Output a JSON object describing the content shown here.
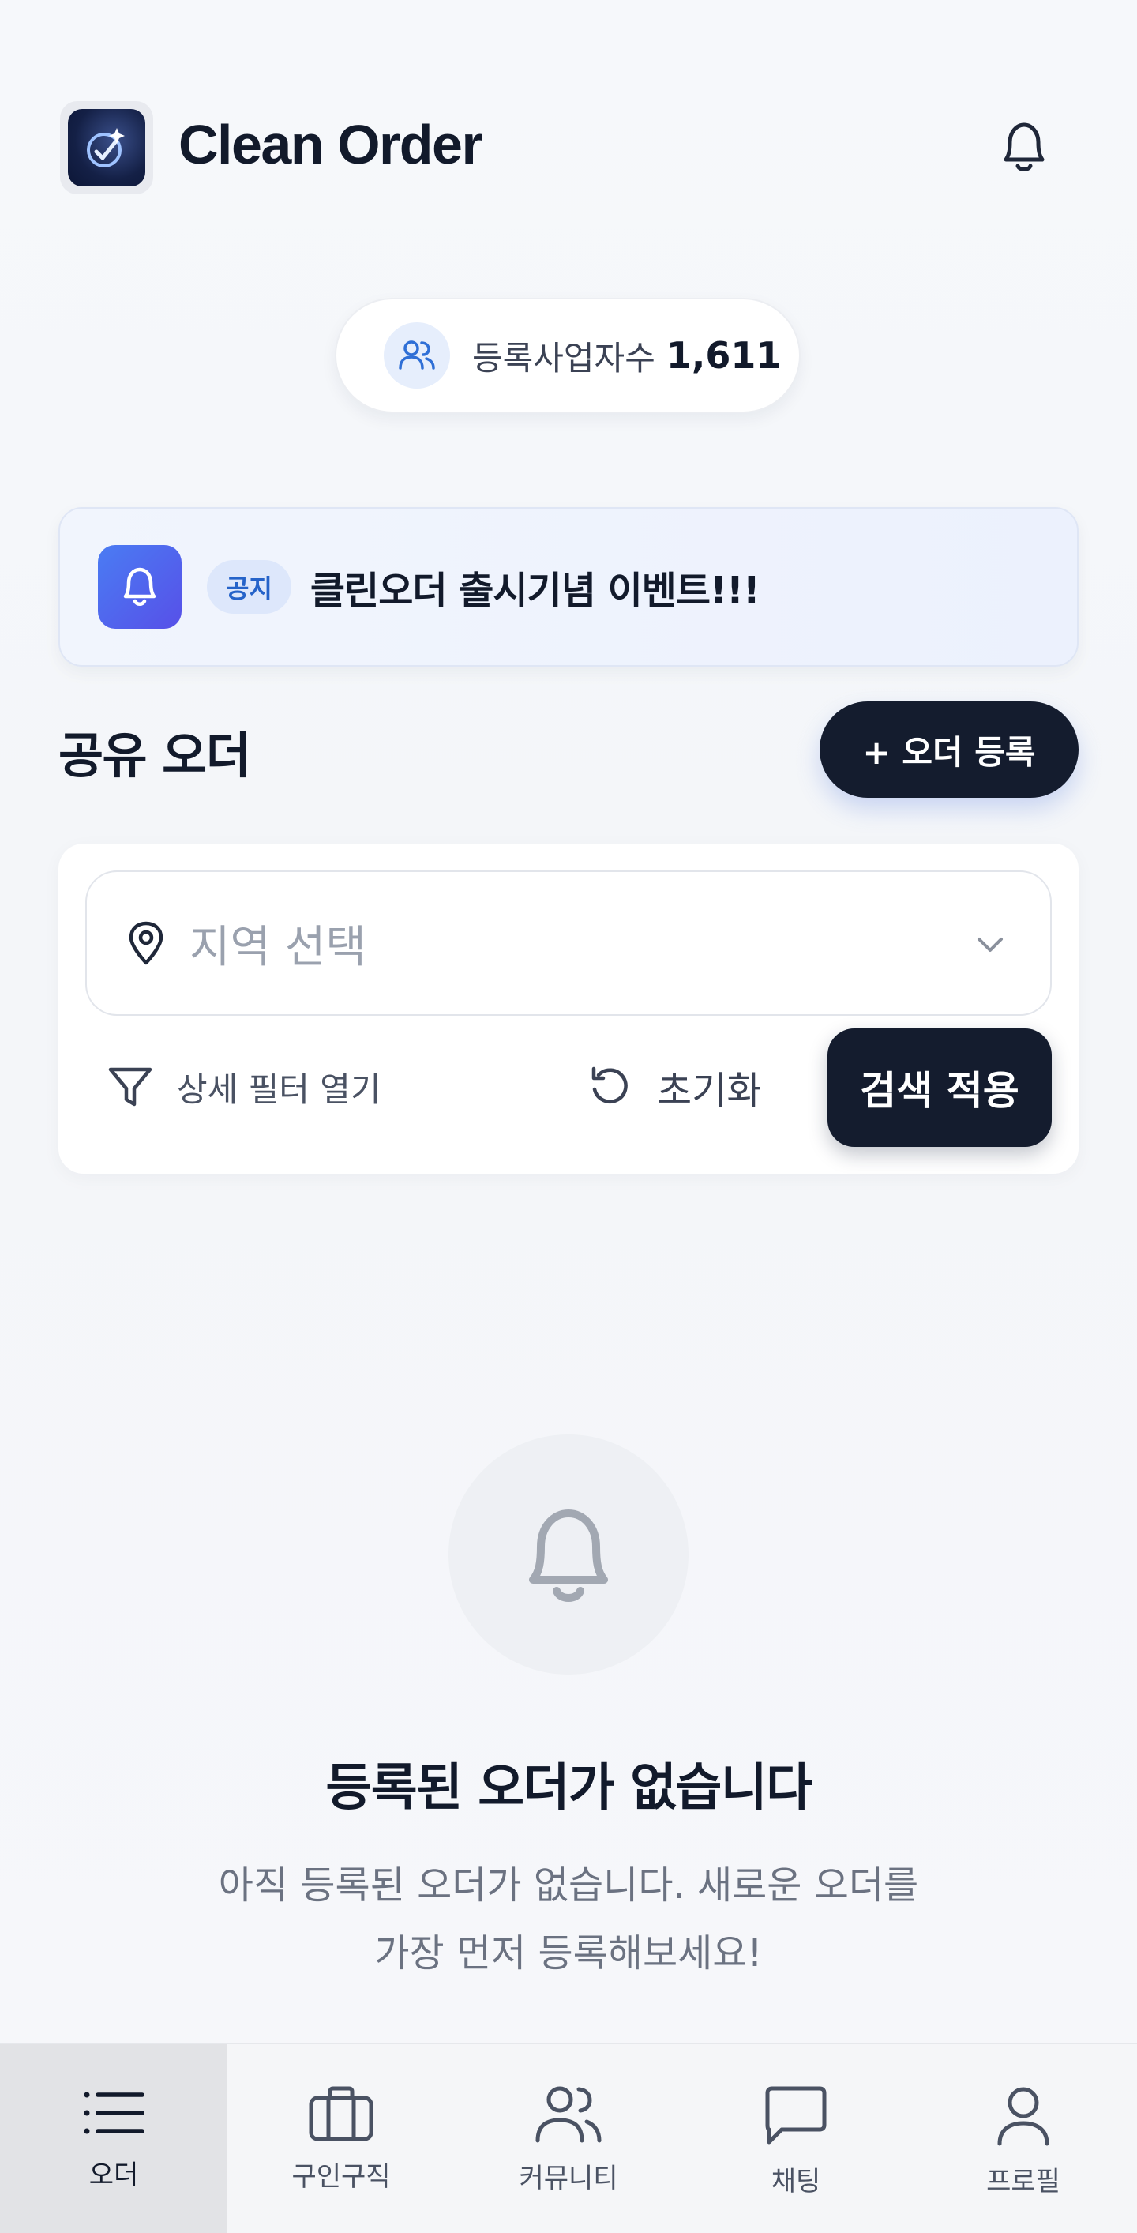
{
  "app": {
    "title": "Clean Order"
  },
  "stats": {
    "label": "등록사업자수",
    "count": "1,611"
  },
  "notice": {
    "badge": "공지",
    "text": "클린오더 출시기념 이벤트!!!"
  },
  "section": {
    "title": "공유 오더",
    "add_button": "+ 오더 등록"
  },
  "filter": {
    "region_placeholder": "지역 선택",
    "detail_filter": "상세 필터 열기",
    "reset": "초기화",
    "apply": "검색 적용"
  },
  "empty": {
    "title": "등록된 오더가 없습니다",
    "line1": "아직 등록된 오더가 없습니다. 새로운 오더를",
    "line2": "가장 먼저 등록해보세요!"
  },
  "nav": [
    {
      "label": "오더",
      "icon": "list-icon",
      "active": true
    },
    {
      "label": "구인구직",
      "icon": "briefcase-icon",
      "active": false
    },
    {
      "label": "커뮤니티",
      "icon": "users-icon",
      "active": false
    },
    {
      "label": "채팅",
      "icon": "chat-icon",
      "active": false
    },
    {
      "label": "프로필",
      "icon": "user-icon",
      "active": false
    }
  ],
  "colors": {
    "primary_dark": "#141c2e",
    "accent_blue": "#2563c9",
    "notice_bg": "#ecf1fd",
    "muted_text": "#6b7281"
  }
}
